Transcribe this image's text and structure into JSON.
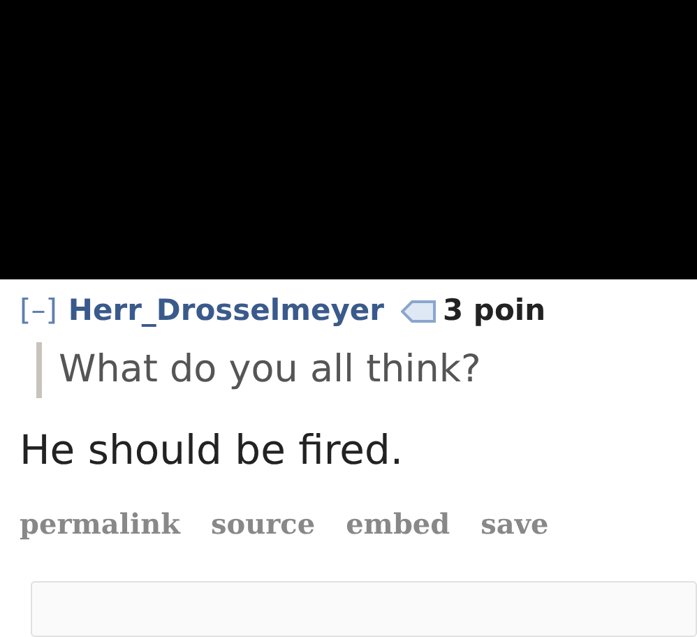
{
  "comment": {
    "collapse": "[–]",
    "author": "Herr_Drosselmeyer",
    "points": "3 poin",
    "quote": "What do you all think?",
    "body": "He should be fired.",
    "actions": [
      "permalink",
      "source",
      "embed",
      "save"
    ]
  }
}
